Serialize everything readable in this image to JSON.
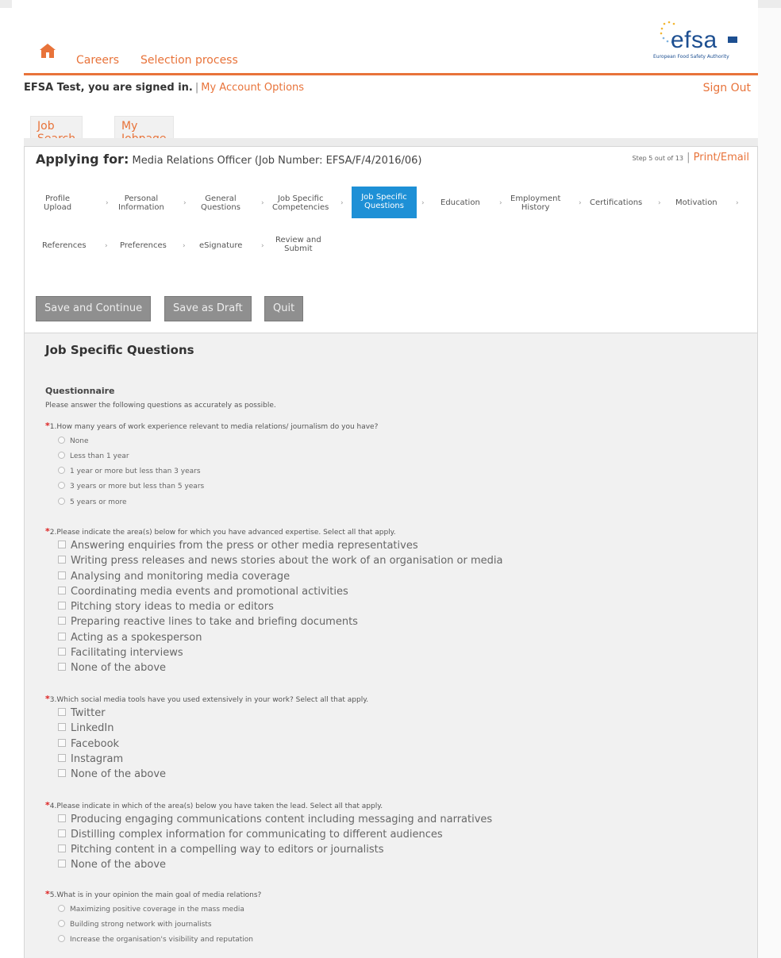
{
  "header": {
    "nav": [
      "Careers",
      "Selection process"
    ],
    "logo_text": "efsa",
    "logo_sub": "European Food Safety Authority",
    "accent": "#e8733a",
    "brand": "#1d4f91"
  },
  "account": {
    "signed_in": "EFSA Test, you are signed in.",
    "separator": "|",
    "options": "My Account Options",
    "sign_out": "Sign Out"
  },
  "tabs": [
    "Job Search",
    "My Jobpage"
  ],
  "applying": {
    "label": "Applying for:",
    "job": "Media Relations Officer (Job Number: EFSA/F/4/2016/06)",
    "step_info": "Step 5 out of 13",
    "separator": "|",
    "print": "Print/Email"
  },
  "steps": [
    [
      "Profile",
      "Upload"
    ],
    [
      "Personal",
      "Information"
    ],
    [
      "General",
      "Questions"
    ],
    [
      "Job Specific",
      "Competencies"
    ],
    [
      "Job Specific",
      "Questions"
    ],
    [
      "Education"
    ],
    [
      "Employment",
      "History"
    ],
    [
      "Certifications"
    ],
    [
      "Motivation"
    ],
    [
      "References"
    ],
    [
      "Preferences"
    ],
    [
      "eSignature"
    ],
    [
      "Review and",
      "Submit"
    ]
  ],
  "step_active_color": "#1e90d6",
  "buttons": [
    "Save and Continue",
    "Save as Draft",
    "Quit"
  ],
  "section": {
    "title": "Job Specific Questions",
    "sub": "Questionnaire",
    "intro": "Please answer the following questions as accurately as possible."
  },
  "questions": [
    {
      "text": "1.How many years of work experience relevant to media relations/ journalism do you have?",
      "type": "radio",
      "options": [
        "None",
        "Less than 1 year",
        "1 year or more but less than 3 years",
        "3 years or more but less than 5 years",
        "5 years or more"
      ]
    },
    {
      "text": "2.Please indicate the area(s) below for which you have advanced expertise. Select all that apply.",
      "type": "checkbox",
      "options": [
        "Answering enquiries from the press or other media representatives",
        "Writing press releases and news stories about the work of an organisation or media",
        "Analysing and monitoring media coverage",
        "Coordinating media events and promotional activities",
        "Pitching story ideas to media or editors",
        "Preparing reactive lines to take and briefing documents",
        "Acting as a spokesperson",
        "Facilitating interviews",
        "None of the above"
      ]
    },
    {
      "text": "3.Which social media tools have you used extensively in your work? Select all that apply.",
      "type": "checkbox",
      "options": [
        "Twitter",
        "LinkedIn",
        "Facebook",
        "Instagram",
        "None of the above"
      ]
    },
    {
      "text": "4.Please indicate in which of the area(s) below you have taken the lead. Select all that apply.",
      "type": "checkbox",
      "options": [
        "Producing engaging communications content including messaging and narratives",
        "Distilling complex information for communicating to different audiences",
        "Pitching content in a compelling way to editors or journalists",
        "None of the above"
      ]
    },
    {
      "text": "5.What is in your opinion the main goal of media relations?",
      "type": "radio",
      "options": [
        "Maximizing positive coverage in the mass media",
        "Building strong network with journalists",
        "Increase the organisation's visibility and reputation"
      ]
    }
  ],
  "required_mark": "*"
}
